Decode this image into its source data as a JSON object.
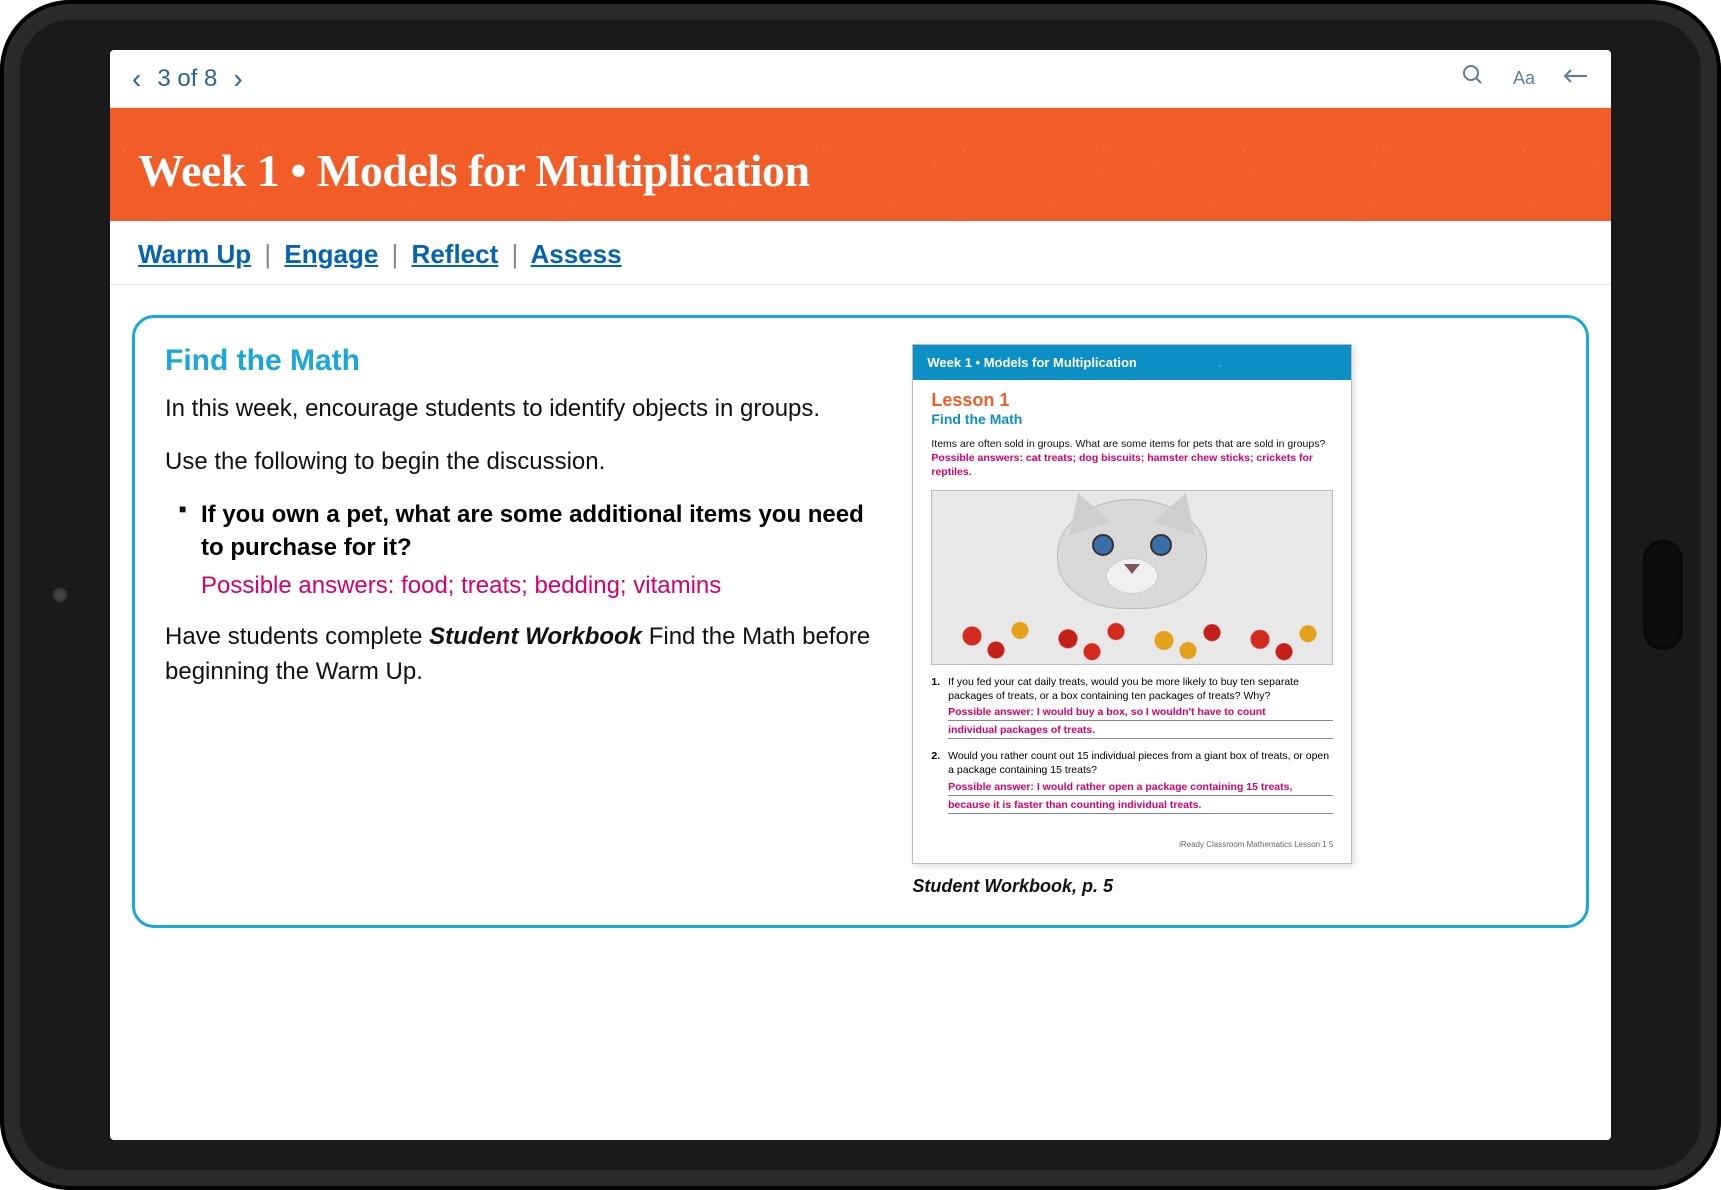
{
  "topbar": {
    "page_indicator": "3 of 8",
    "aa": "Aa"
  },
  "banner": {
    "title": "Week 1 • Models for Multiplication"
  },
  "quicknav": {
    "links": [
      "Warm Up",
      "Engage",
      "Reflect",
      "Assess"
    ],
    "separator": "|"
  },
  "main": {
    "section_title": "Find the Math",
    "p1": "In this week, encourage students to identify objects in groups.",
    "p2": "Use the following to begin the discussion.",
    "bullet": {
      "question": "If you own a pet, what are some additional items you need to purchase for it?",
      "answer": "Possible answers: food; treats; bedding; vitamins"
    },
    "p3_a": "Have students complete ",
    "p3_b": "Student Workbook",
    "p3_c": " Find the Math before beginning the Warm Up."
  },
  "workbook": {
    "banner": "Week 1 • Models for Multiplication",
    "lesson_num": "Lesson 1",
    "lesson_title": "Find the Math",
    "intro_plain": "Items are often sold in groups. What are some items for pets that are sold in groups? ",
    "intro_answer": "Possible answers: cat treats; dog biscuits; hamster chew sticks; crickets for reptiles.",
    "q1": {
      "num": "1.",
      "text": "If you fed your cat daily treats, would you be more likely to buy ten separate packages of treats, or a box containing ten packages of treats? Why?",
      "ans_a": "Possible answer: I would buy a box, so I wouldn't have to count",
      "ans_b": "individual packages of treats."
    },
    "q2": {
      "num": "2.",
      "text": "Would you rather count out 15 individual pieces from a giant box of treats, or open a package containing 15 treats?",
      "ans_a": "Possible answer: I would rather open a package containing 15 treats,",
      "ans_b": "because it is faster than counting individual treats."
    },
    "footer": "iReady Classroom Mathematics   Lesson 1   5",
    "caption": "Student Workbook, p. 5"
  }
}
